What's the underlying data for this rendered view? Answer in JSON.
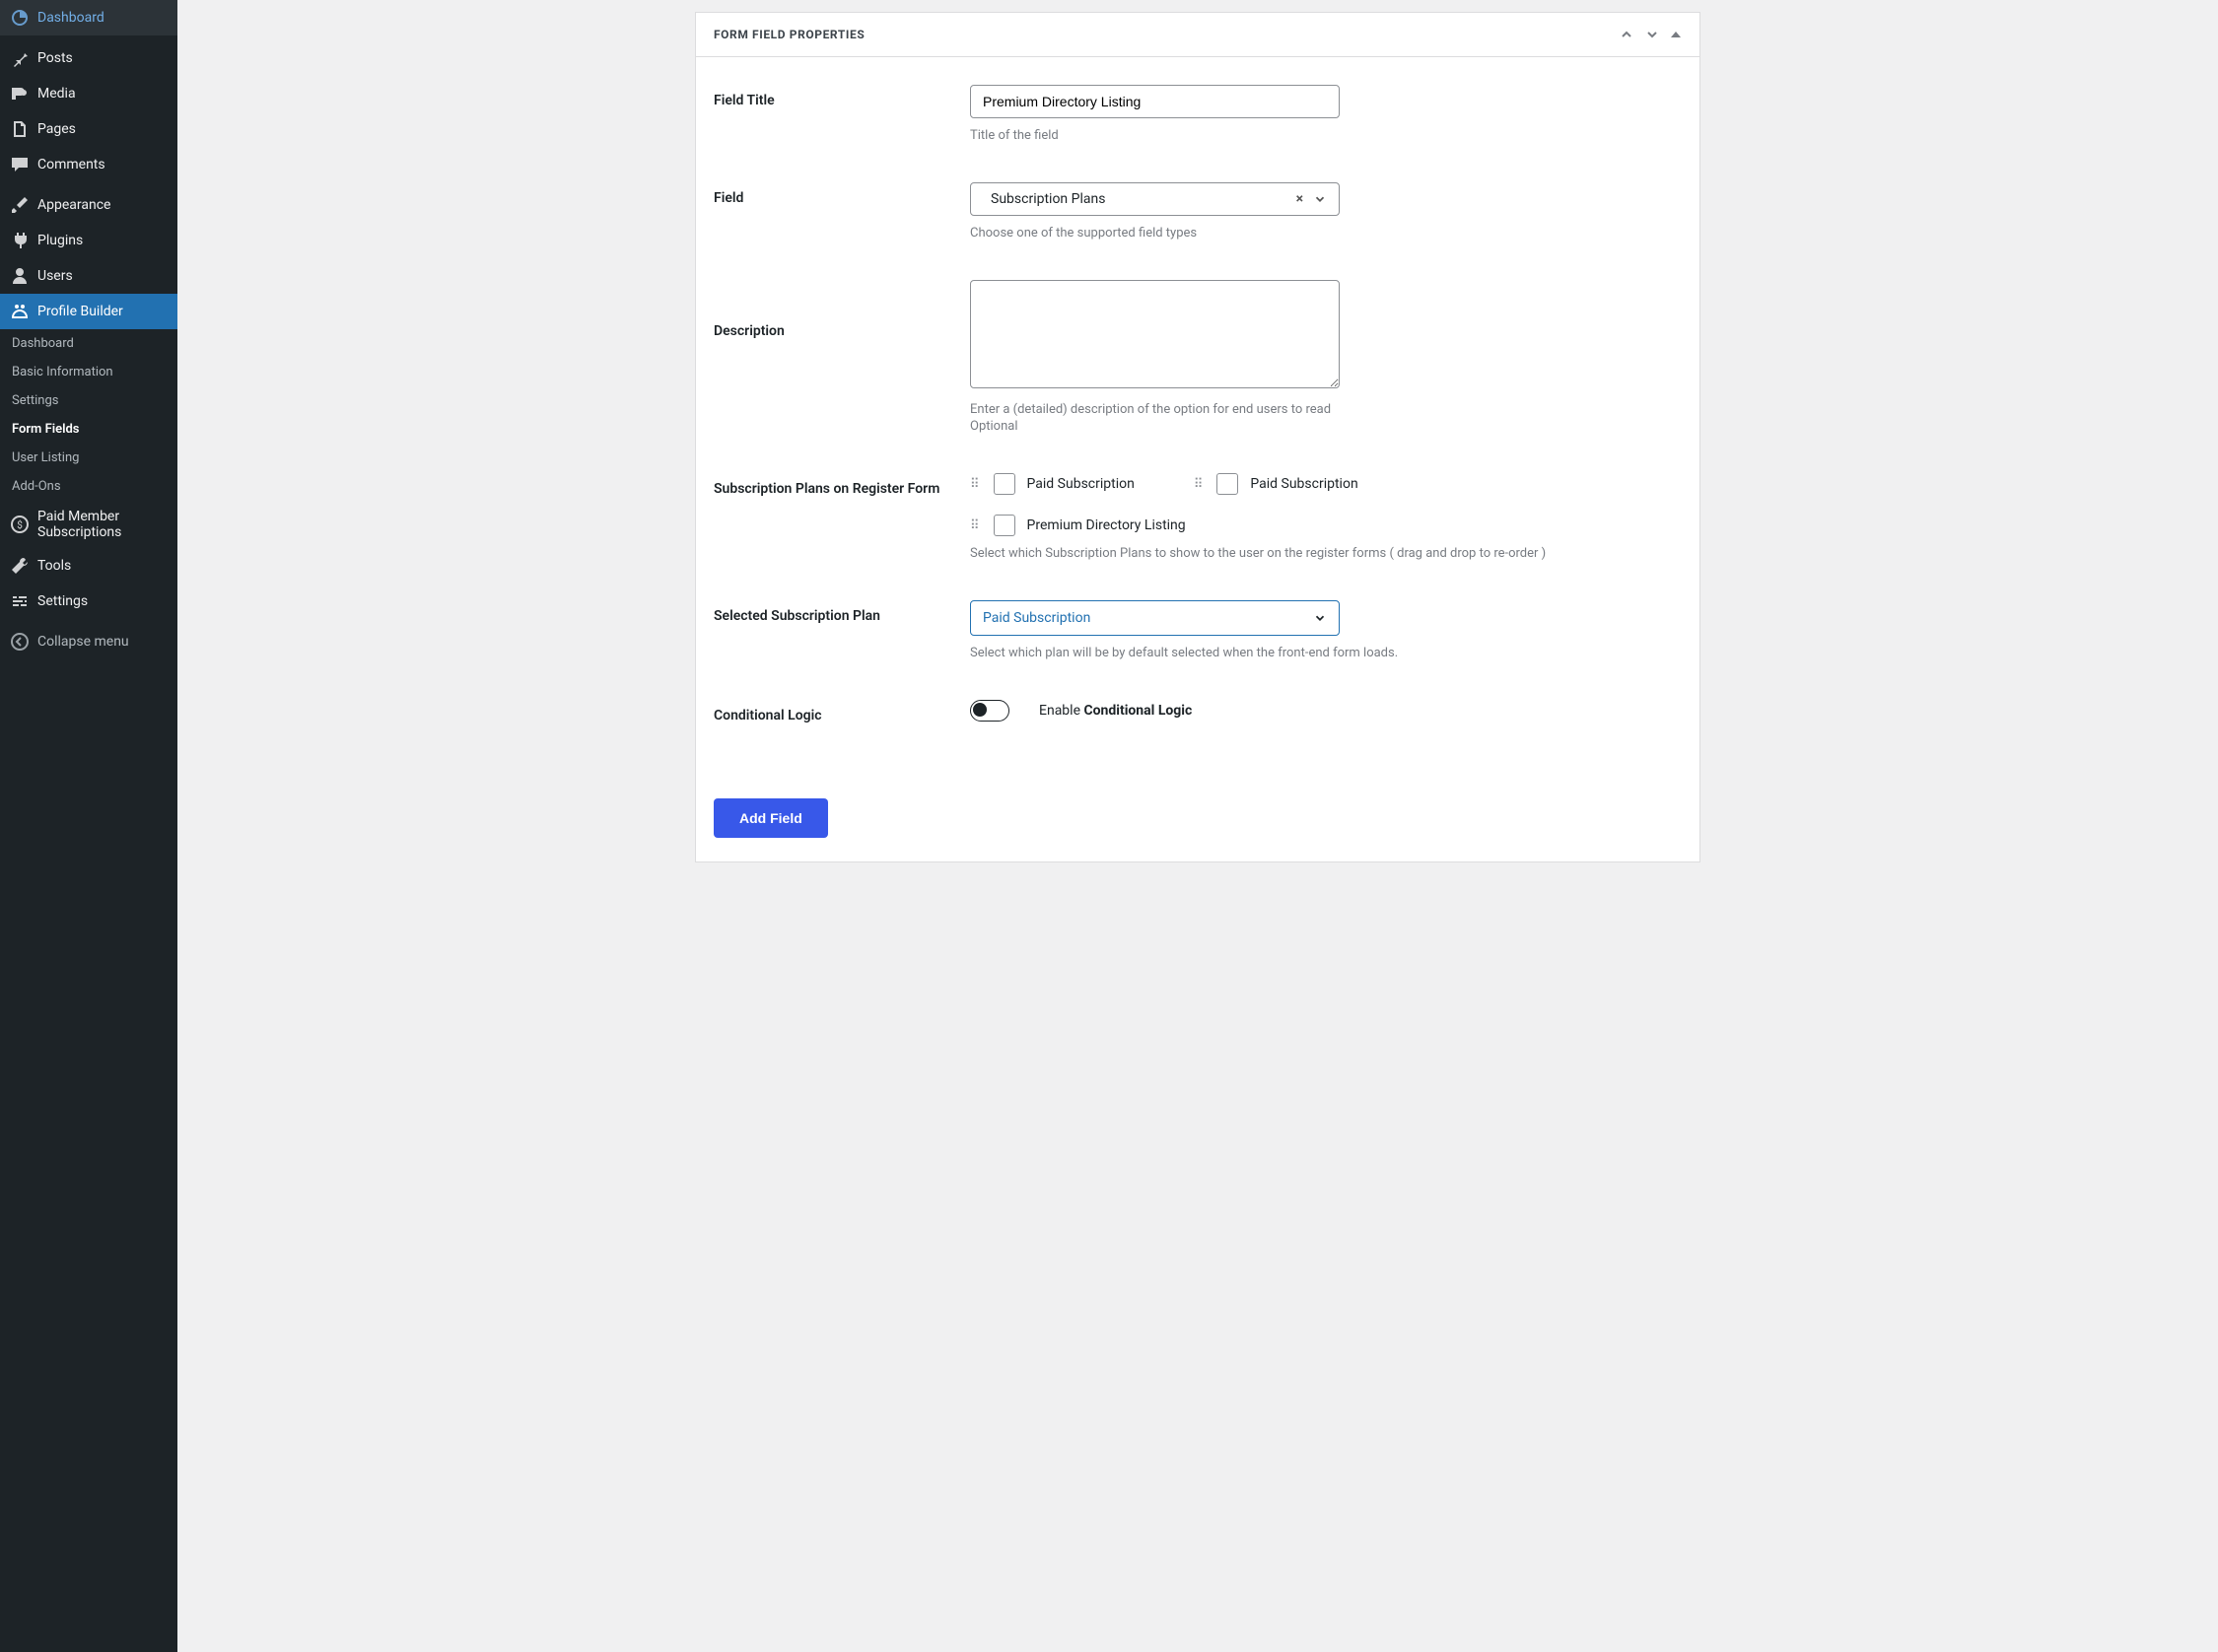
{
  "sidebar": {
    "items": [
      {
        "label": "Dashboard"
      },
      {
        "label": "Posts"
      },
      {
        "label": "Media"
      },
      {
        "label": "Pages"
      },
      {
        "label": "Comments"
      },
      {
        "label": "Appearance"
      },
      {
        "label": "Plugins"
      },
      {
        "label": "Users"
      },
      {
        "label": "Profile Builder"
      },
      {
        "label": "Paid Member Subscriptions"
      },
      {
        "label": "Tools"
      },
      {
        "label": "Settings"
      },
      {
        "label": "Collapse menu"
      }
    ],
    "submenu": [
      {
        "label": "Dashboard"
      },
      {
        "label": "Basic Information"
      },
      {
        "label": "Settings"
      },
      {
        "label": "Form Fields"
      },
      {
        "label": "User Listing"
      },
      {
        "label": "Add-Ons"
      }
    ]
  },
  "panel": {
    "title": "FORM FIELD PROPERTIES",
    "field_title": {
      "label": "Field Title",
      "value": "Premium Directory Listing",
      "helper": "Title of the field"
    },
    "field_type": {
      "label": "Field",
      "value": "Subscription Plans",
      "helper": "Choose one of the supported field types"
    },
    "description": {
      "label": "Description",
      "value": "",
      "helper1": "Enter a (detailed) description of the option for end users to read",
      "helper2": "Optional"
    },
    "plans": {
      "label": "Subscription Plans on Register Form",
      "items": [
        {
          "label": "Paid Subscription"
        },
        {
          "label": "Paid Subscription"
        },
        {
          "label": "Premium Directory Listing"
        }
      ],
      "helper": "Select which Subscription Plans to show to the user on the register forms ( drag and drop to re-order )"
    },
    "selected_plan": {
      "label": "Selected Subscription Plan",
      "value": "Paid Subscription",
      "helper": "Select which plan will be by default selected when the front-end form loads."
    },
    "conditional": {
      "label": "Conditional Logic",
      "toggle_label_prefix": "Enable ",
      "toggle_label_bold": "Conditional Logic"
    },
    "add_button": "Add Field"
  }
}
